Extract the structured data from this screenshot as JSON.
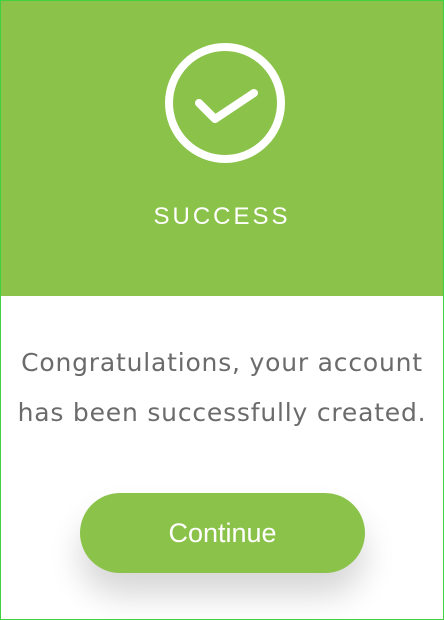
{
  "dialog": {
    "status_title": "SUCCESS",
    "message_line_1": "Congratulations, your account",
    "message_line_2": "has been successfully created.",
    "continue_label": "Continue"
  },
  "icons": {
    "status": "check-circle-icon"
  },
  "colors": {
    "accent": "#8bc34a",
    "text": "#6b6b6b",
    "background": "#ffffff",
    "border": "#3fd13f"
  }
}
